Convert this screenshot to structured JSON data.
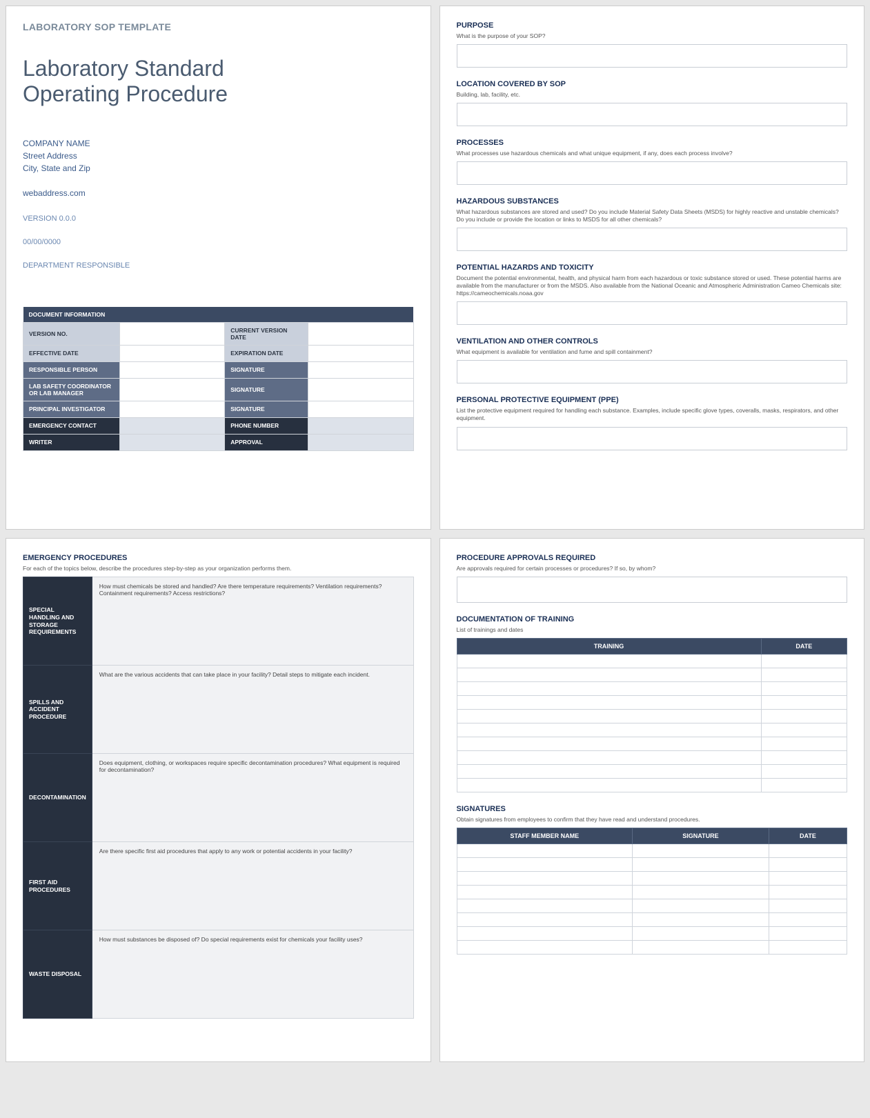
{
  "page1": {
    "template_label": "LABORATORY SOP TEMPLATE",
    "title_line1": "Laboratory Standard",
    "title_line2": "Operating Procedure",
    "company_name": "COMPANY NAME",
    "street": "Street Address",
    "city": "City, State and Zip",
    "web": "webaddress.com",
    "version": "VERSION 0.0.0",
    "date": "00/00/0000",
    "department": "DEPARTMENT RESPONSIBLE",
    "docinfo_header": "DOCUMENT INFORMATION",
    "rows": {
      "version_no": "VERSION NO.",
      "current_version_date": "CURRENT VERSION DATE",
      "effective_date": "EFFECTIVE DATE",
      "expiration_date": "EXPIRATION DATE",
      "responsible_person": "RESPONSIBLE PERSON",
      "signature": "SIGNATURE",
      "lab_safety": "LAB SAFETY COORDINATOR OR LAB MANAGER",
      "principal": "PRINCIPAL INVESTIGATOR",
      "emergency_contact": "EMERGENCY CONTACT",
      "phone_number": "PHONE NUMBER",
      "writer": "WRITER",
      "approval": "APPROVAL"
    }
  },
  "page2": {
    "purpose": {
      "title": "PURPOSE",
      "desc": "What is the purpose of your SOP?"
    },
    "location": {
      "title": "LOCATION COVERED BY SOP",
      "desc": "Building, lab, facility, etc."
    },
    "processes": {
      "title": "PROCESSES",
      "desc": "What processes use hazardous chemicals and what unique equipment, if any, does each process involve?"
    },
    "hazardous": {
      "title": "HAZARDOUS SUBSTANCES",
      "desc": "What hazardous substances are stored and used? Do you include Material Safety Data Sheets (MSDS) for highly reactive and unstable chemicals? Do you include or provide the location or links to MSDS for all other chemicals?"
    },
    "potential": {
      "title": "POTENTIAL HAZARDS AND TOXICITY",
      "desc": "Document the potential environmental, health, and physical harm from each hazardous or toxic substance stored or used. These potential harms are available from the manufacturer or from the MSDS. Also available from the National Oceanic and Atmospheric Administration Cameo Chemicals site: https://cameochemicals.noaa.gov"
    },
    "ventilation": {
      "title": "VENTILATION AND OTHER CONTROLS",
      "desc": "What equipment is available for ventilation and fume and spill containment?"
    },
    "ppe": {
      "title": "PERSONAL PROTECTIVE EQUIPMENT (PPE)",
      "desc": "List the protective equipment required for handling each substance. Examples, include specific glove types, coveralls, masks, respirators, and other equipment."
    }
  },
  "page3": {
    "title": "EMERGENCY PROCEDURES",
    "desc": "For each of the topics below, describe the procedures step-by-step as your organization performs them.",
    "rows": [
      {
        "label": "SPECIAL HANDLING AND STORAGE REQUIREMENTS",
        "prompt": "How must chemicals be stored and handled? Are there temperature requirements? Ventilation requirements? Containment requirements? Access restrictions?"
      },
      {
        "label": "SPILLS AND ACCIDENT PROCEDURE",
        "prompt": "What are the various accidents that can take place in your facility? Detail steps to mitigate each incident."
      },
      {
        "label": "DECONTAMINATION",
        "prompt": "Does equipment, clothing, or workspaces require specific decontamination procedures? What equipment is required for decontamination?"
      },
      {
        "label": "FIRST AID PROCEDURES",
        "prompt": "Are there specific first aid procedures that apply to any work or potential accidents in your facility?"
      },
      {
        "label": "WASTE DISPOSAL",
        "prompt": "How must substances be disposed of? Do special requirements exist for chemicals your facility uses?"
      }
    ]
  },
  "page4": {
    "approvals": {
      "title": "PROCEDURE APPROVALS REQUIRED",
      "desc": "Are approvals required for certain processes or procedures?  If so, by whom?"
    },
    "training": {
      "title": "DOCUMENTATION OF TRAINING",
      "desc": "List of trainings and dates",
      "col1": "TRAINING",
      "col2": "DATE",
      "row_count": 10
    },
    "signatures": {
      "title": "SIGNATURES",
      "desc": "Obtain signatures from employees to confirm that they have read and understand procedures.",
      "col1": "STAFF MEMBER NAME",
      "col2": "SIGNATURE",
      "col3": "DATE",
      "row_count": 8
    }
  }
}
